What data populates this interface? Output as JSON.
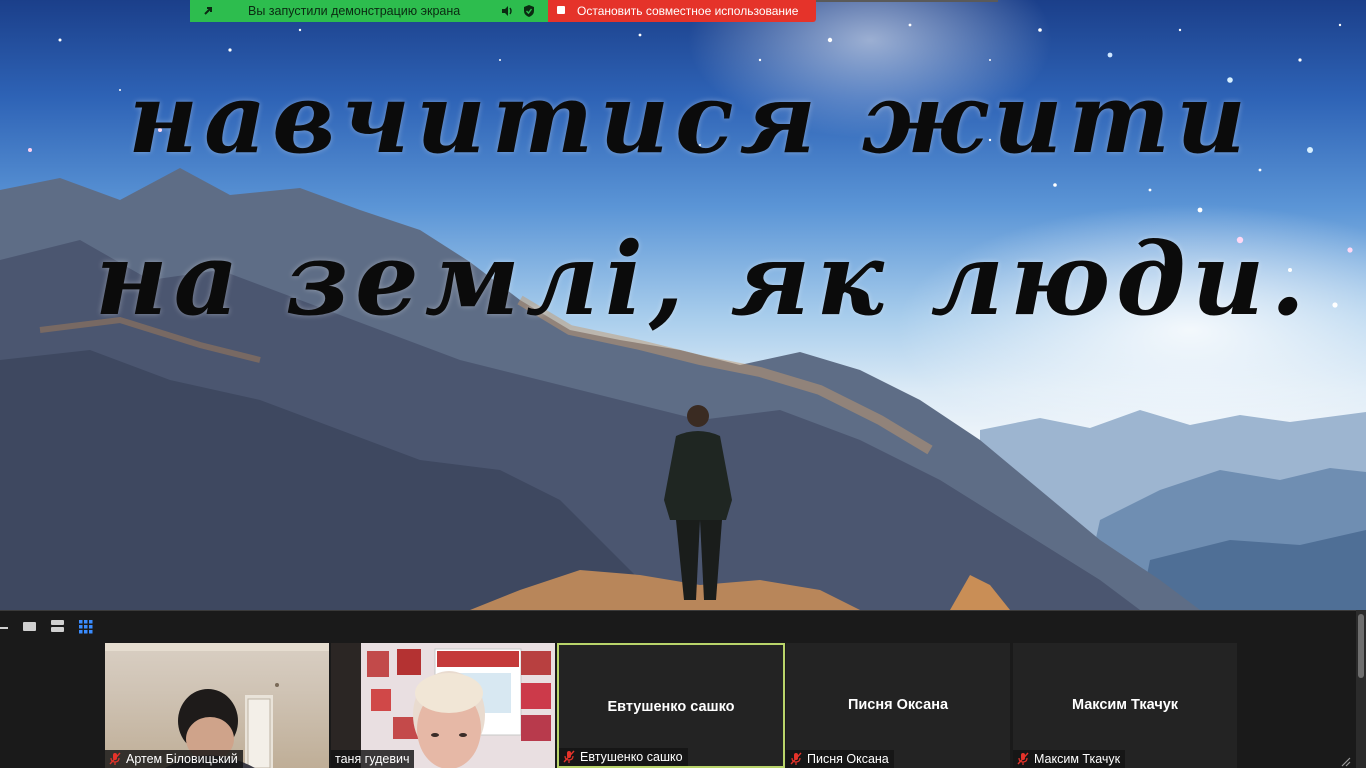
{
  "share_toolbar": {
    "status_text": "Вы запустили демонстрацию экрана",
    "stop_text": "Остановить совместное использование",
    "status_color": "#2dbd4e",
    "stop_color": "#e5332a",
    "icons": [
      "share-arrow-icon",
      "audio-icon",
      "security-shield-icon",
      "stop-icon"
    ]
  },
  "slide": {
    "line1": "навчитися жити",
    "line2": "на землі, як люди."
  },
  "view_controls": [
    "minimize-icon",
    "speaker-view-icon",
    "strip-view-icon",
    "gallery-view-icon"
  ],
  "participants": [
    {
      "label": "Артем Біловицький",
      "name": "",
      "has_video": true,
      "muted": true
    },
    {
      "label": "таня гудевич",
      "name": "",
      "has_video": true,
      "muted": false
    },
    {
      "label": "Евтушенко сашко",
      "name": "Евтушенко сашко",
      "has_video": false,
      "muted": true,
      "active": true
    },
    {
      "label": "Писня Оксана",
      "name": "Писня Оксана",
      "has_video": false,
      "muted": true
    },
    {
      "label": "Максим Ткачук",
      "name": "Максим Ткачук",
      "has_video": false,
      "muted": true
    }
  ],
  "colors": {
    "active_border": "#b9d46a",
    "mic_off": "#e5332a"
  }
}
